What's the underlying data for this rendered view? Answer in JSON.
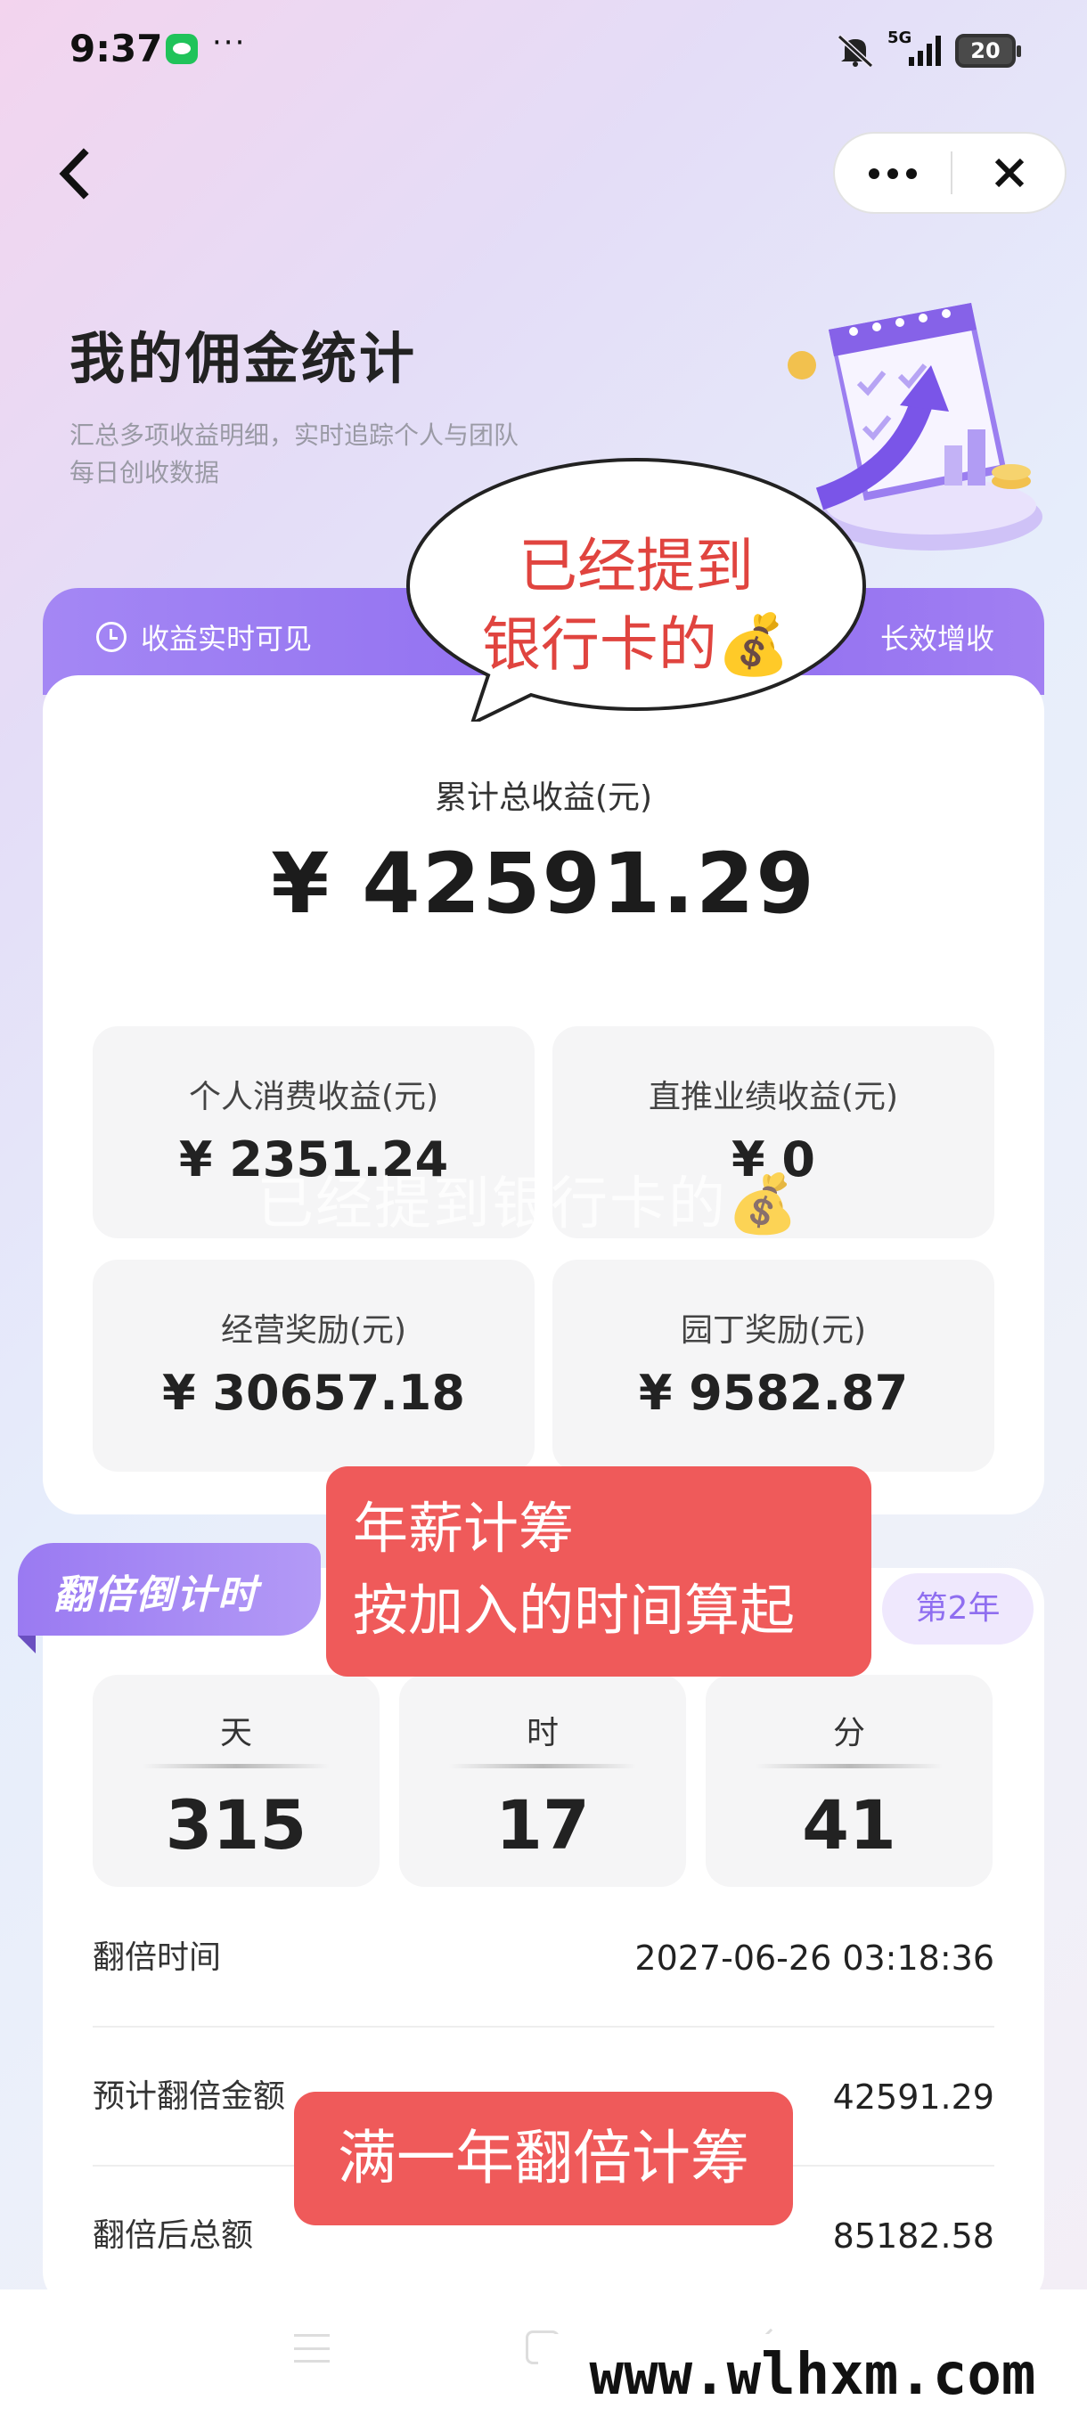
{
  "status_bar": {
    "time": "9:37",
    "dots": "···",
    "network": "5G",
    "battery": "20"
  },
  "header": {
    "title": "我的佣金统计",
    "subtitle_line1": "汇总多项收益明细，实时追踪个人与团队",
    "subtitle_line2": "每日创收数据"
  },
  "summary": {
    "tab_left": "收益实时可见",
    "tab_right": "长效增收",
    "total_label": "累计总收益(元)",
    "total_value": "¥ 42591.29",
    "stats": [
      {
        "label": "个人消费收益(元)",
        "value": "¥ 2351.24"
      },
      {
        "label": "直推业绩收益(元)",
        "value": "¥ 0"
      },
      {
        "label": "经营奖励(元)",
        "value": "¥ 30657.18"
      },
      {
        "label": "园丁奖励(元)",
        "value": "¥ 9582.87"
      }
    ]
  },
  "countdown": {
    "title": "翻倍倒计时",
    "year_badge": "第2年",
    "units": [
      {
        "label": "天",
        "value": "315"
      },
      {
        "label": "时",
        "value": "17"
      },
      {
        "label": "分",
        "value": "41"
      }
    ],
    "rows": [
      {
        "label": "翻倍时间",
        "value": "2027-06-26 03:18:36"
      },
      {
        "label": "预计翻倍金额",
        "value": "42591.29"
      },
      {
        "label": "翻倍后总额",
        "value": "85182.58"
      }
    ]
  },
  "annotations": {
    "bubble_line1": "已经提到",
    "bubble_line2": "银行卡的💰",
    "watermark": "已经提到银行卡的💰",
    "note_a_line1": "年薪计筹",
    "note_a_line2": "按加入的时间算起",
    "note_b": "满一年翻倍计筹",
    "site": "www.wlhxm.com"
  },
  "colors": {
    "accent": "#8f6ef0",
    "note": "#ef5a5a",
    "bubble_text": "#e0443f"
  }
}
